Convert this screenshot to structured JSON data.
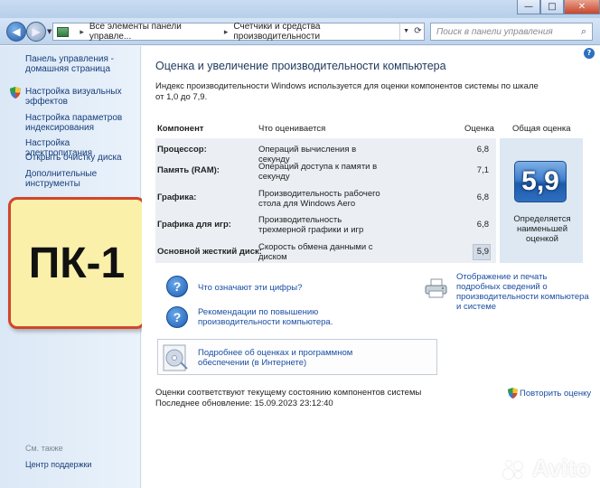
{
  "window": {
    "minimize": "—",
    "maximize": "□",
    "close": "✕"
  },
  "navbar": {
    "back_glyph": "◀",
    "forward_glyph": "▶",
    "breadcrumb": [
      "Все элементы панели управле...",
      "Счетчики и средства производительности"
    ],
    "breadcrumb_separator": "▸",
    "search_placeholder": "Поиск в панели управления"
  },
  "sidebar": {
    "items": [
      {
        "label": "Панель управления - домашняя страница",
        "shield": false
      },
      {
        "label": "Настройка визуальных эффектов",
        "shield": true
      },
      {
        "label": "Настройка параметров индексирования",
        "shield": false
      },
      {
        "label": "Настройка электропитания",
        "shield": false
      },
      {
        "label": "Открыть очистку диска",
        "shield": false
      },
      {
        "label": "Дополнительные инструменты",
        "shield": false
      }
    ],
    "sticker": "ПК-1",
    "see_also": "См. также",
    "support": "Центр поддержки"
  },
  "main": {
    "title": "Оценка и увеличение производительности компьютера",
    "intro": "Индекс производительности Windows используется для оценки компонентов системы по шкале от 1,0 до 7,9.",
    "table": {
      "headers": {
        "component": "Компонент",
        "what": "Что оценивается",
        "score": "Оценка",
        "overall": "Общая оценка"
      },
      "rows": [
        {
          "component": "Процессор:",
          "what": "Операций вычисления в секунду",
          "score": "6,8"
        },
        {
          "component": "Память (RAM):",
          "what": "Операций доступа к памяти в секунду",
          "score": "7,1"
        },
        {
          "component": "Графика:",
          "what": "Производительность рабочего стола для Windows Aero",
          "score": "6,8"
        },
        {
          "component": "Графика для игр:",
          "what": "Производительность трехмерной графики и игр",
          "score": "6,8"
        },
        {
          "component": "Основной жесткий диск:",
          "what": "Скорость обмена данными с диском",
          "score": "5,9"
        }
      ],
      "overall_score": "5,9",
      "overall_note": "Определяется наименьшей оценкой"
    },
    "links": {
      "what_numbers": "Что означают эти цифры?",
      "recommendations": "Рекомендации по повышению производительности компьютера.",
      "print": "Отображение и печать подробных сведений о производительности компьютера и системе",
      "more_info": "Подробнее об оценках и программном обеспечении (в Интернете)"
    },
    "status_line1": "Оценки соответствуют текущему состоянию компонентов системы",
    "status_line2": "Последнее обновление: 15.09.2023 23:12:40",
    "rerun": "Повторить оценку"
  },
  "watermark": "Avito",
  "colors": {
    "link": "#1a4ea3",
    "sticker_bg": "#fbf0a9",
    "sticker_border": "#d1452b",
    "score_tile": "#3f7fcf"
  }
}
